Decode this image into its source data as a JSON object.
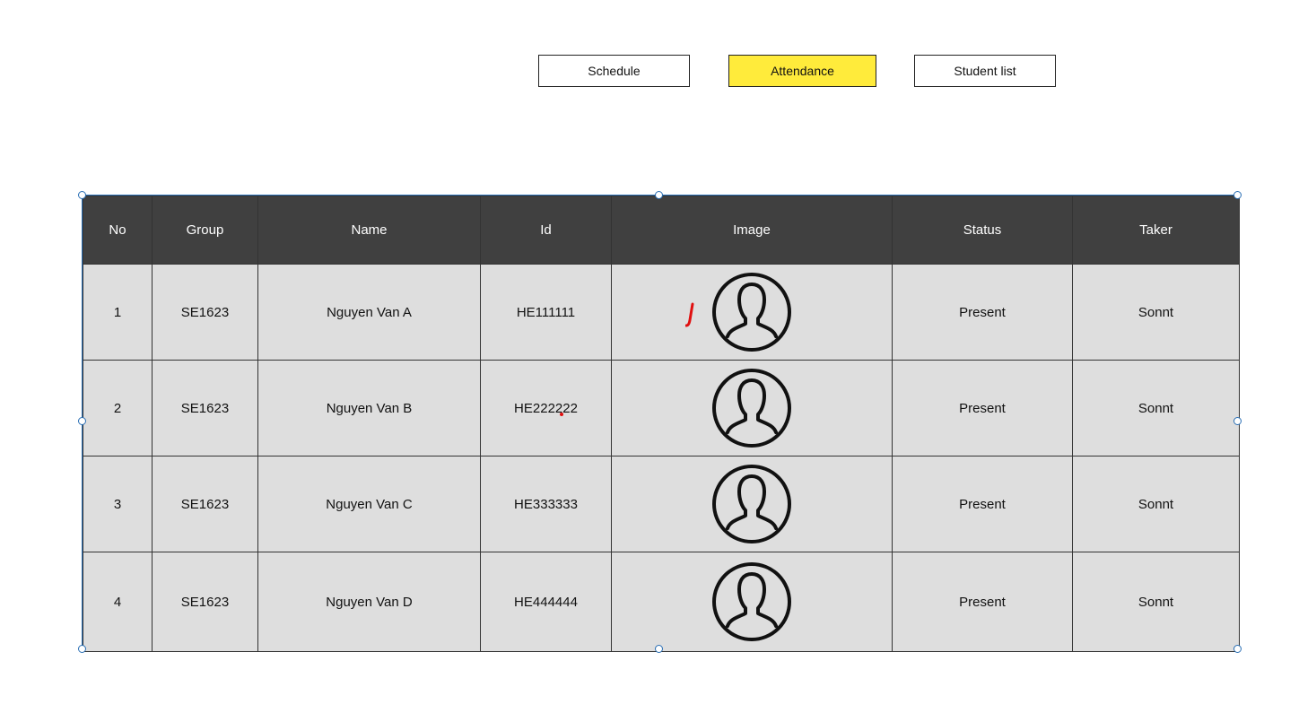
{
  "nav": {
    "schedule_label": "Schedule",
    "attendance_label": "Attendance",
    "students_label": "Student list",
    "active_color": "#ffeb3b"
  },
  "table": {
    "headers": [
      "No",
      "Group",
      "Name",
      "Id",
      "Image",
      "Status",
      "Taker"
    ],
    "rows": [
      {
        "no": "1",
        "group": "SE1623",
        "name": "Nguyen Van A",
        "id": "HE111111",
        "image": "avatar-icon",
        "status": "Present",
        "taker": "Sonnt"
      },
      {
        "no": "2",
        "group": "SE1623",
        "name": "Nguyen Van B",
        "id": "HE222222",
        "image": "avatar-icon",
        "status": "Present",
        "taker": "Sonnt"
      },
      {
        "no": "3",
        "group": "SE1623",
        "name": "Nguyen Van C",
        "id": "HE333333",
        "image": "avatar-icon",
        "status": "Present",
        "taker": "Sonnt"
      },
      {
        "no": "4",
        "group": "SE1623",
        "name": "Nguyen Van D",
        "id": "HE444444",
        "image": "avatar-icon",
        "status": "Present",
        "taker": "Sonnt"
      }
    ],
    "header_color": "#404040",
    "cell_color": "#dedede",
    "selection_color": "#2a6fb5"
  }
}
